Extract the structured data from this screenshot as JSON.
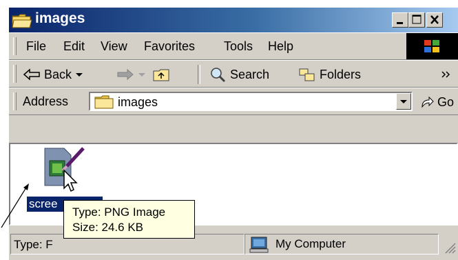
{
  "window": {
    "title": "images"
  },
  "menu": [
    "File",
    "Edit",
    "View",
    "Favorites",
    "Tools",
    "Help"
  ],
  "toolbar": {
    "back_label": "Back",
    "search_label": "Search",
    "folders_label": "Folders"
  },
  "address": {
    "label": "Address",
    "value": "images",
    "go_label": "Go"
  },
  "file": {
    "name": "scree"
  },
  "tooltip": {
    "line1": "Type: PNG Image",
    "line2": "Size: 24.6 KB"
  },
  "status": {
    "left": "Type: F",
    "zone": "My Computer"
  },
  "colors": {
    "title_start": "#0a246a",
    "title_end": "#a6caf0",
    "selection": "#0a246a",
    "tooltip_bg": "#ffffe1"
  }
}
